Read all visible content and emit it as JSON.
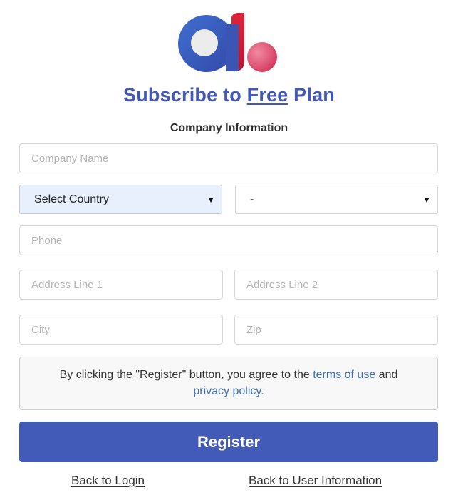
{
  "brand": {
    "logo_icon": "brand-logo-icon",
    "colors": {
      "blue": "#4258b5",
      "red": "#d9203a",
      "pink": "#e05a78"
    }
  },
  "header": {
    "title_prefix": "Subscribe to",
    "title_plan": "Free",
    "title_suffix": "Plan"
  },
  "section": {
    "label": "Company Information"
  },
  "form": {
    "company_name": {
      "placeholder": "Company Name",
      "value": ""
    },
    "country": {
      "selected": "Select Country"
    },
    "state": {
      "selected": "-"
    },
    "phone": {
      "placeholder": "Phone",
      "value": ""
    },
    "address1": {
      "placeholder": "Address Line 1",
      "value": ""
    },
    "address2": {
      "placeholder": "Address Line 2",
      "value": ""
    },
    "city": {
      "placeholder": "City",
      "value": ""
    },
    "zip": {
      "placeholder": "Zip",
      "value": ""
    }
  },
  "agreement": {
    "text_before": "By clicking the \"Register\" button, you agree to the",
    "terms_link": "terms of use",
    "text_and": "and",
    "privacy_link": "privacy policy."
  },
  "actions": {
    "register_label": "Register",
    "back_login_label": "Back to Login",
    "back_user_label": "Back to User Information"
  },
  "colors": {
    "primary": "#425bb9",
    "link": "#3d6cb0",
    "select_highlight": "#e8f0fe"
  }
}
